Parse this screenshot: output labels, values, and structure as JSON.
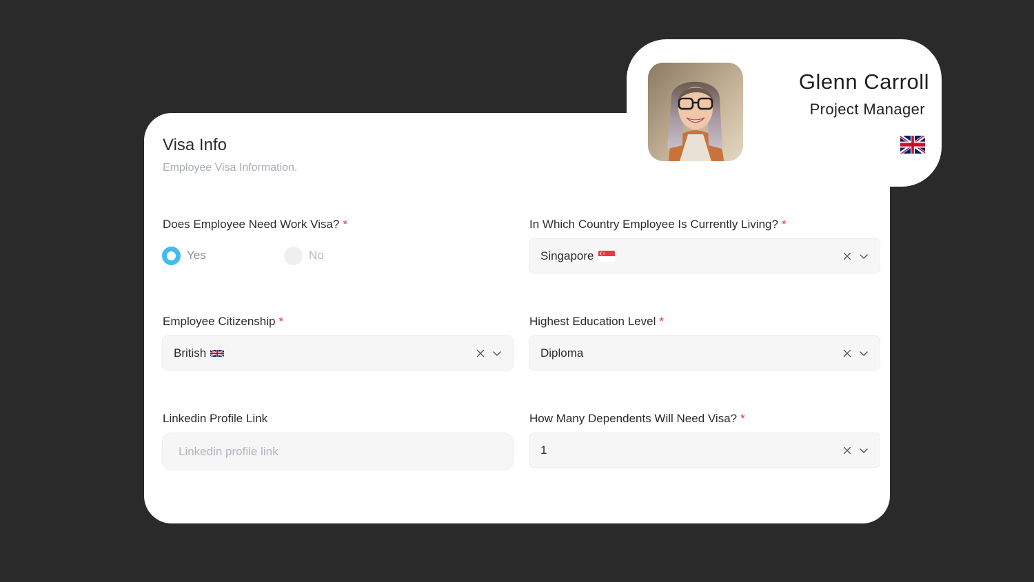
{
  "form": {
    "title": "Visa Info",
    "subtitle": "Employee Visa Information.",
    "required_marker": "*",
    "fields": {
      "work_visa": {
        "label": "Does Employee Need Work Visa?",
        "options": [
          "Yes",
          "No"
        ],
        "selected": "Yes"
      },
      "living_country": {
        "label": "In Which Country Employee Is Currently Living?",
        "value": "Singapore",
        "flag_icon": "singapore-flag-icon"
      },
      "citizenship": {
        "label": "Employee Citizenship",
        "value": "British",
        "flag_icon": "uk-flag-icon"
      },
      "education": {
        "label": "Highest Education Level",
        "value": "Diploma"
      },
      "linkedin": {
        "label": "Linkedin Profile Link",
        "placeholder": "Linkedin profile link",
        "value": ""
      },
      "dependents": {
        "label": "How Many Dependents Will Need Visa?",
        "value": "1"
      }
    },
    "select_icons": [
      "clear-icon",
      "chevron-down-icon"
    ]
  },
  "profile": {
    "name": "Glenn Carroll",
    "role": "Project Manager",
    "flag_icon": "uk-flag-icon",
    "avatar_icon": "avatar"
  },
  "colors": {
    "background": "#2a2a2a",
    "card": "#ffffff",
    "accent": "#42bbed",
    "required": "#e5343d",
    "muted_text": "#a9adb6",
    "input_bg": "#f6f6f7"
  }
}
